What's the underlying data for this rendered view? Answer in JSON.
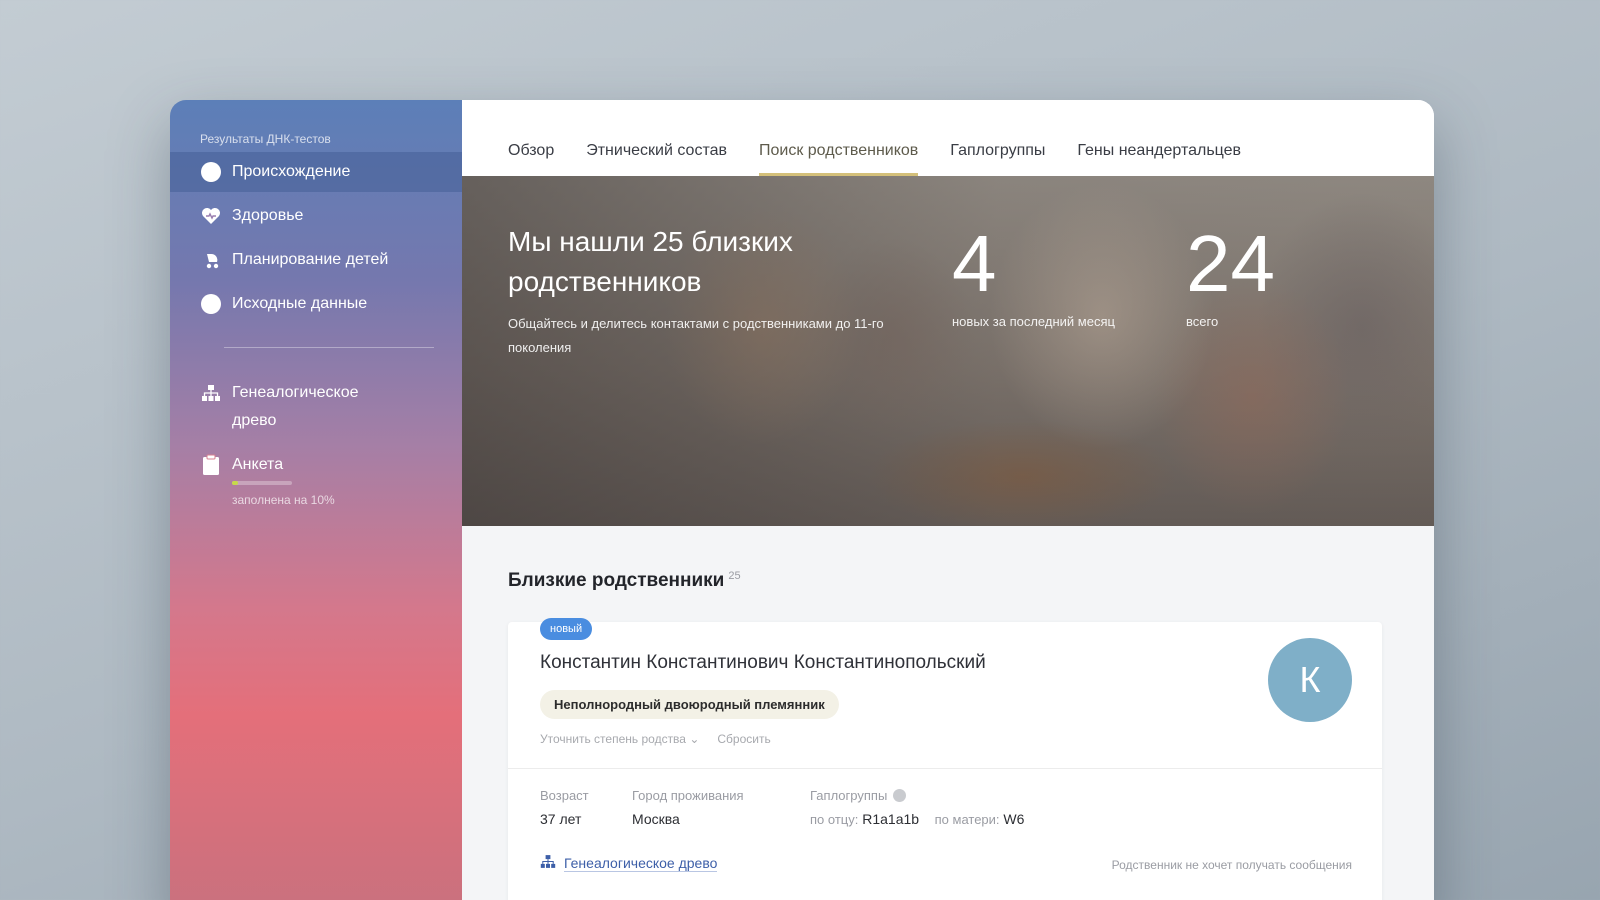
{
  "sidebar": {
    "title": "Результаты ДНК-тестов",
    "items": [
      {
        "label": "Происхождение",
        "icon": "circle-icon"
      },
      {
        "label": "Здоровье",
        "icon": "heart-icon"
      },
      {
        "label": "Планирование детей",
        "icon": "stroller-icon"
      },
      {
        "label": "Исходные данные",
        "icon": "circle-icon"
      }
    ],
    "tree_label": "Генеалогическое древо",
    "questionnaire_label": "Анкета",
    "questionnaire_sub": "заполнена на 10%",
    "questionnaire_progress": 0.1
  },
  "tabs": [
    "Обзор",
    "Этнический состав",
    "Поиск родственников",
    "Гаплогруппы",
    "Гены неандертальцев"
  ],
  "active_tab": "Поиск родственников",
  "hero": {
    "title": "Мы нашли 25 близких родственников",
    "description": "Общайтесь и делитесь контактами с родственниками до 11-го поколения",
    "stat_new_value": "4",
    "stat_new_label": "новых за последний месяц",
    "stat_total_value": "24",
    "stat_total_label": "всего"
  },
  "section": {
    "title": "Близкие родственники",
    "count": "25"
  },
  "relative": {
    "badge": "новый",
    "name": "Константин Константинович Константинопольский",
    "relation": "Неполнородный двоюродный племянник",
    "refine_link": "Уточнить степень родства",
    "reset_link": "Сбросить",
    "avatar_letter": "К",
    "age_label": "Возраст",
    "age_value": "37 лет",
    "city_label": "Город проживания",
    "city_value": "Москва",
    "haplo_label": "Гаплогруппы",
    "paternal_label": "по отцу:",
    "paternal_value": "R1a1a1b",
    "maternal_label": "по матери:",
    "maternal_value": "W6",
    "tree_link": "Генеалогическое древо",
    "no_messages": "Родственник не хочет получать сообщения"
  },
  "colors": {
    "accent": "#4a8de0",
    "tab_underline": "#d4c07a",
    "avatar": "#7fafc8"
  }
}
